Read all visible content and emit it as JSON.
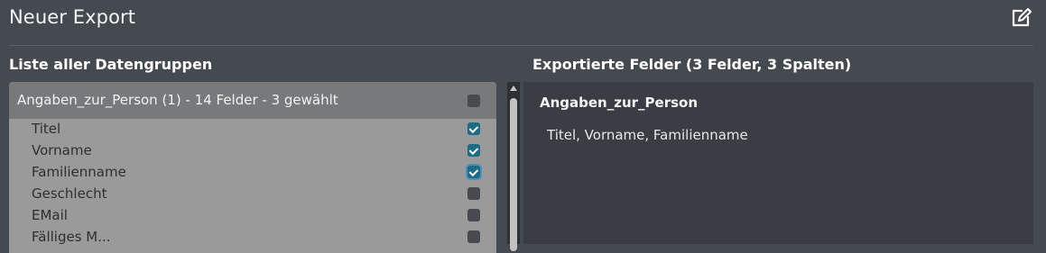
{
  "header": {
    "title": "Neuer Export",
    "edit_icon": "edit-icon"
  },
  "left": {
    "section_title": "Liste aller Datengruppen",
    "group": {
      "label": "Angaben_zur_Person (1) - 14 Felder - 3 gewählt",
      "checked": false
    },
    "fields": [
      {
        "label": "Titel",
        "checked": true
      },
      {
        "label": "Vorname",
        "checked": true
      },
      {
        "label": "Familienname",
        "checked": true,
        "focused": true
      },
      {
        "label": "Geschlecht",
        "checked": false
      },
      {
        "label": "EMail",
        "checked": false
      },
      {
        "label": "Fälliges M...",
        "checked": false
      }
    ]
  },
  "right": {
    "section_title": "Exportierte Felder (3 Felder, 3 Spalten)",
    "group_name": "Angaben_zur_Person",
    "fields_text": "Titel, Vorname, Familienname"
  },
  "colors": {
    "background": "#454a51",
    "checkbox_checked": "#1e6b84",
    "checkbox_unchecked": "#474b50",
    "group_header": "#77797b",
    "field_list": "#9a9a9a",
    "export_panel": "#3a3e44"
  }
}
